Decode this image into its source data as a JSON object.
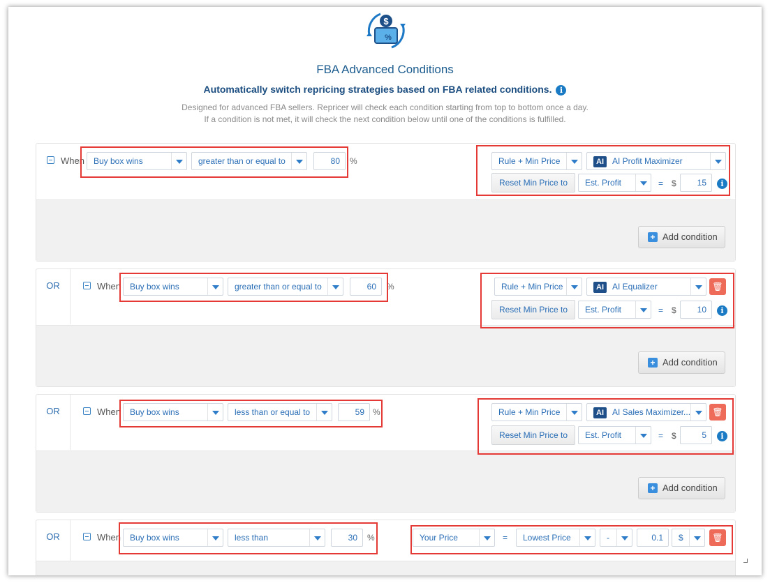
{
  "header": {
    "title": "FBA Advanced Conditions",
    "subtitle": "Automatically switch repricing strategies based on FBA related conditions.",
    "description_line1": "Designed for advanced FBA sellers. Repricer will check each condition starting from top to bottom once a day.",
    "description_line2": "If a condition is not met, it will check the next condition below until one of the conditions is fulfilled."
  },
  "common": {
    "when": "When",
    "or": "OR",
    "percent": "%",
    "equals": "=",
    "dollar": "$",
    "add_condition": "Add condition",
    "info": "i",
    "ai": "AI",
    "plus": "+",
    "trash": "🗑"
  },
  "conditions": [
    {
      "metric": "Buy box wins",
      "operator": "greater than or equal to",
      "value": "80",
      "action": "Rule + Min Price",
      "strategy": "AI Profit Maximizer",
      "reset_label": "Reset Min Price to",
      "reset_basis": "Est. Profit",
      "reset_value": "15"
    },
    {
      "metric": "Buy box wins",
      "operator": "greater than or equal to",
      "value": "60",
      "action": "Rule + Min Price",
      "strategy": "AI Equalizer",
      "reset_label": "Reset Min Price to",
      "reset_basis": "Est. Profit",
      "reset_value": "10"
    },
    {
      "metric": "Buy box wins",
      "operator": "less than or equal to",
      "value": "59",
      "action": "Rule + Min Price",
      "strategy": "AI Sales Maximizer...",
      "reset_label": "Reset Min Price to",
      "reset_basis": "Est. Profit",
      "reset_value": "5"
    },
    {
      "metric": "Buy box wins",
      "operator": "less than",
      "value": "30",
      "price_field": "Your Price",
      "price_basis": "Lowest Price",
      "price_op": "-",
      "price_value": "0.1",
      "price_unit": "$"
    }
  ],
  "colors": {
    "accent": "#2a6eb6",
    "highlight": "#e53935",
    "trash": "#ee6b5a",
    "ai_badge": "#1f4f88"
  }
}
